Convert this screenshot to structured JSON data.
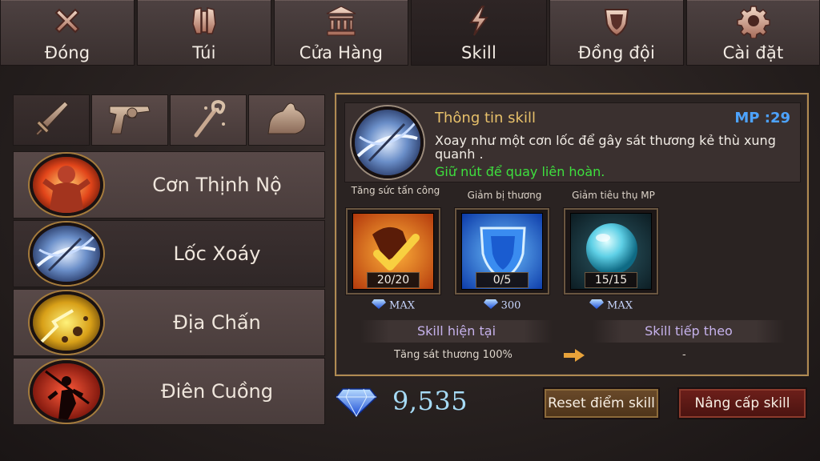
{
  "top_tabs": [
    {
      "label": "Đóng",
      "icon": "close-icon"
    },
    {
      "label": "Túi",
      "icon": "armor-icon"
    },
    {
      "label": "Cửa Hàng",
      "icon": "shop-icon"
    },
    {
      "label": "Skill",
      "icon": "lightning-icon",
      "active": true
    },
    {
      "label": "Đồng đội",
      "icon": "shield-icon"
    },
    {
      "label": "Cài đặt",
      "icon": "gear-icon"
    }
  ],
  "weapon_tabs": [
    {
      "icon": "sword-icon",
      "active": true
    },
    {
      "icon": "revolver-icon"
    },
    {
      "icon": "staff-icon"
    },
    {
      "icon": "muscle-icon"
    }
  ],
  "skills": [
    {
      "name": "Cơn Thịnh Nộ",
      "icon": "rage-icon"
    },
    {
      "name": "Lốc Xoáy",
      "icon": "whirlwind-icon",
      "active": true
    },
    {
      "name": "Địa Chấn",
      "icon": "earthquake-icon"
    },
    {
      "name": "Điên Cuồng",
      "icon": "frenzy-icon"
    }
  ],
  "info": {
    "title": "Thông tin skill",
    "mp": "MP :29",
    "desc": "Xoay như một cơn lốc để gây sát thương kẻ thù xung quanh .",
    "hint": "Giữ nút để quay liên hoàn."
  },
  "upgrades": [
    {
      "label": "Tăng sức tấn công",
      "count": "20/20",
      "cost": "MAX"
    },
    {
      "label": "Giảm bị thương",
      "count": "0/5",
      "cost": "300"
    },
    {
      "label": "Giảm tiêu thụ MP",
      "count": "15/15",
      "cost": "MAX"
    }
  ],
  "current": {
    "head": "Skill hiện tại",
    "value": "Tăng sát thương 100%"
  },
  "next": {
    "head": "Skill tiếp theo",
    "value": "-"
  },
  "gems": "9,535",
  "buttons": {
    "reset": "Reset điểm skill",
    "upgrade": "Nâng cấp skill"
  },
  "colors": {
    "accent_gold": "#e7c06a",
    "mp_blue": "#4da3ff",
    "hint_green": "#3ee03e",
    "gem_blue": "#a6dbf6"
  }
}
